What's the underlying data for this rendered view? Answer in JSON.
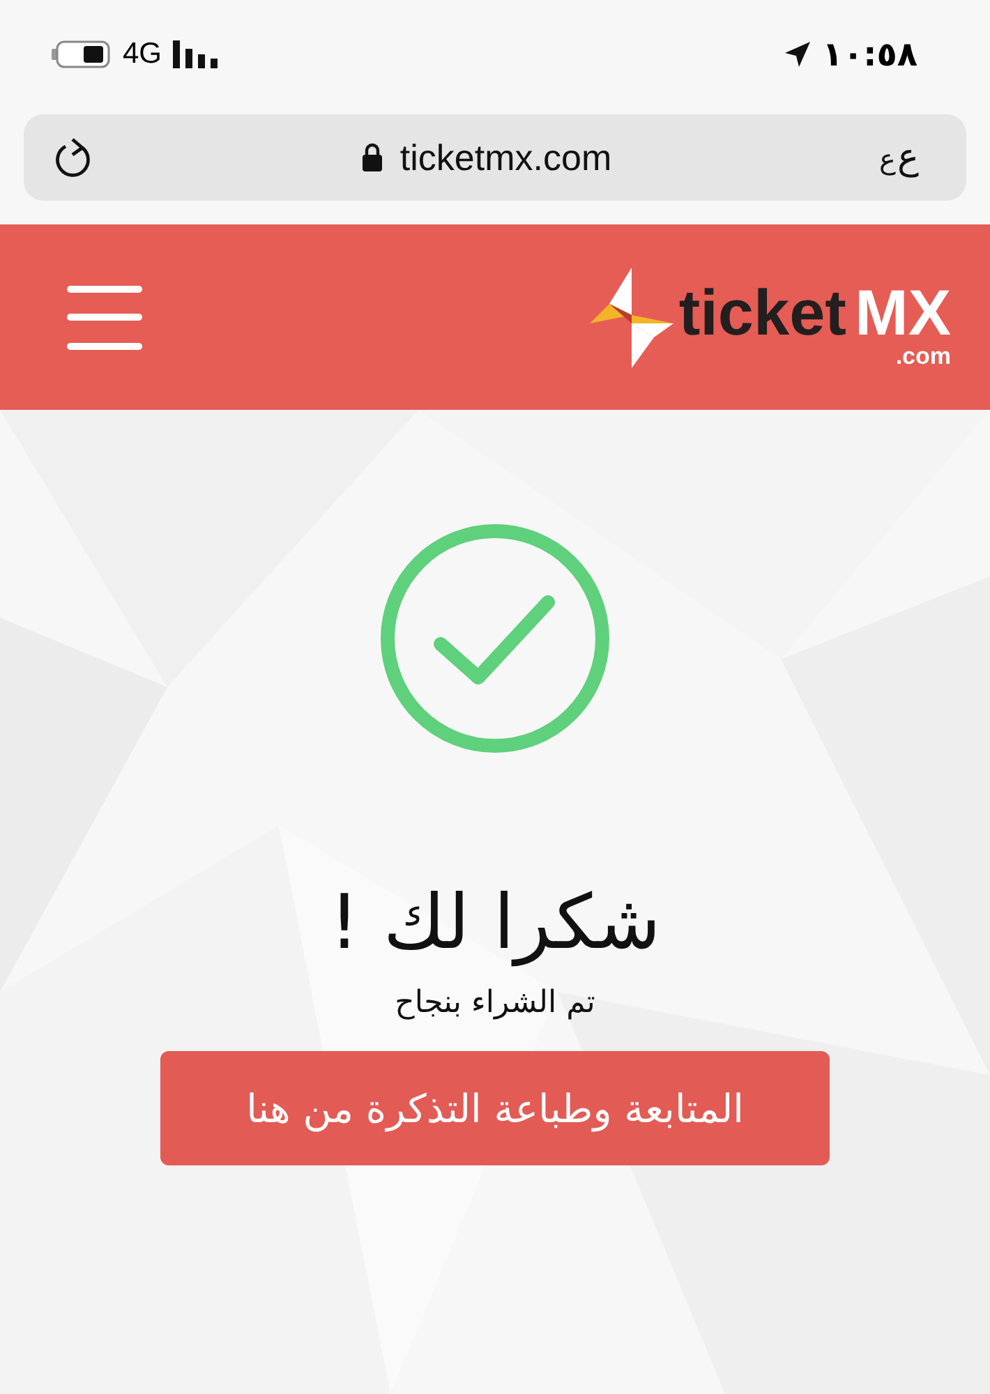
{
  "status_bar": {
    "network": "4G",
    "time": "١٠:٥٨"
  },
  "address_bar": {
    "url": "ticketmx.com",
    "text_size_glyphs": [
      "ع",
      "ع"
    ]
  },
  "header": {
    "logo": {
      "word": "ticket",
      "accent": "MX",
      "suffix": ".com"
    }
  },
  "success": {
    "title": "شكرا لك !",
    "message": "تم الشراء بنجاح",
    "button": "المتابعة وطباعة التذكرة من هنا"
  }
}
